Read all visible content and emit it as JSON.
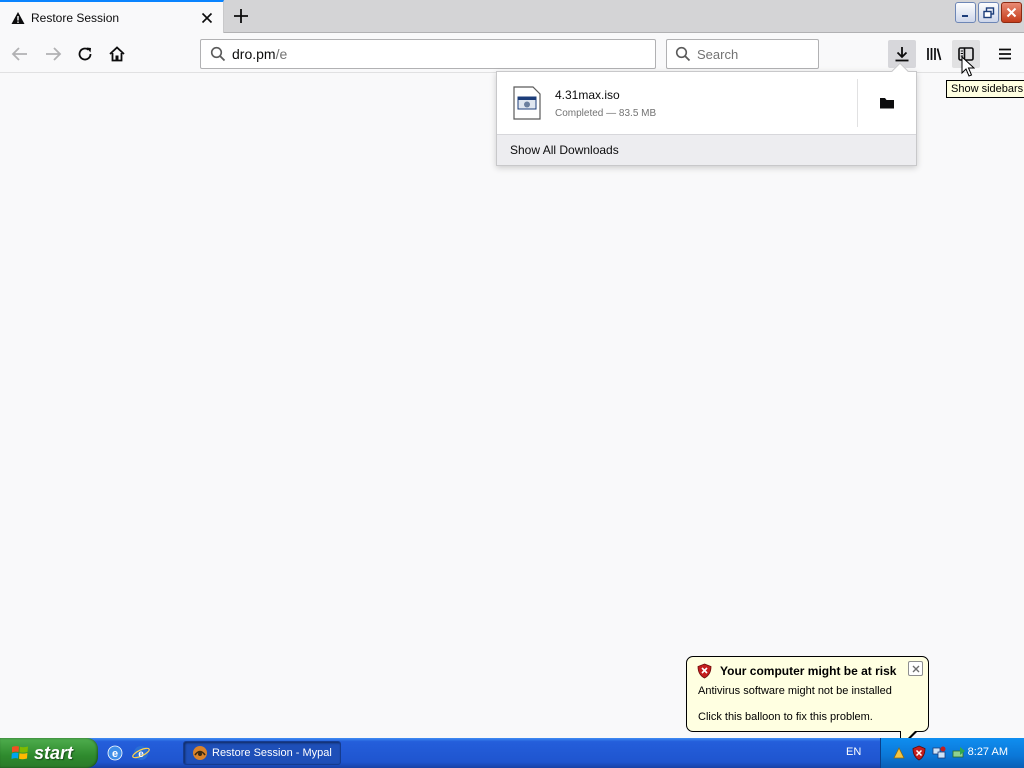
{
  "browser": {
    "tab": {
      "title": "Restore Session",
      "icon": "warning-icon"
    },
    "url": {
      "host": "dro.pm",
      "path": "/e"
    },
    "search": {
      "placeholder": "Search"
    }
  },
  "downloads_panel": {
    "item": {
      "filename": "4.31max.iso",
      "status": "Completed — 83.5 MB"
    },
    "show_all": "Show All Downloads"
  },
  "tooltip": "Show sidebars",
  "balloon": {
    "title": "Your computer might be at risk",
    "line1": "Antivirus software might not be installed",
    "line2": "Click this balloon to fix this problem."
  },
  "taskbar": {
    "start_label": "start",
    "task_button": "Restore Session - Mypal",
    "language": "EN",
    "clock": "8:27 AM"
  },
  "colors": {
    "accent": "#0a84ff",
    "tooltip_bg": "#ffffe1",
    "taskbar": "#245edb",
    "start": "#3c9a3b"
  }
}
